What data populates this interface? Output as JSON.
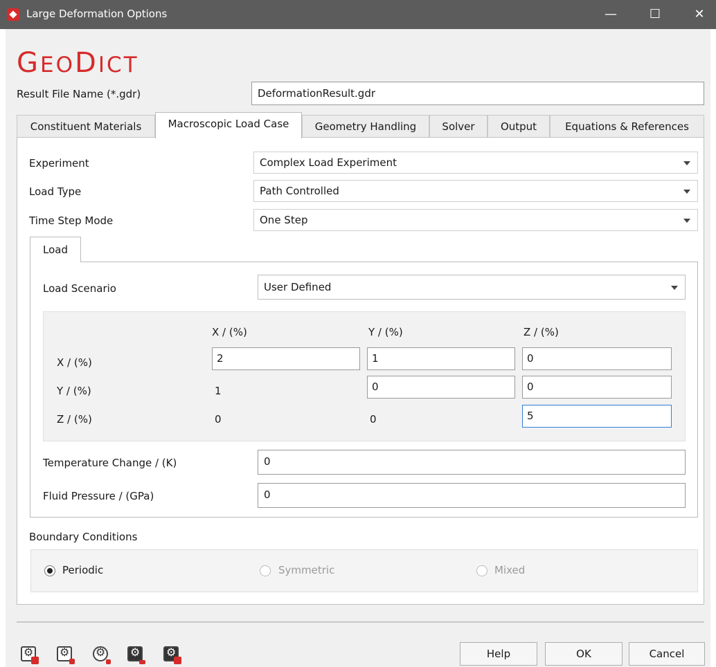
{
  "window": {
    "title": "Large Deformation Options",
    "controls": [
      "—",
      "☐",
      "✕"
    ]
  },
  "logo": {
    "first": "G",
    "rest1": "EO",
    "second": "D",
    "rest2": "ICT"
  },
  "result_file": {
    "label": "Result File Name (*.gdr)",
    "value": "DeformationResult.gdr"
  },
  "tabs": [
    "Constituent Materials",
    "Macroscopic Load Case",
    "Geometry Handling",
    "Solver",
    "Output",
    "Equations & References"
  ],
  "active_tab": "Macroscopic Load Case",
  "experiment": {
    "label": "Experiment",
    "value": "Complex Load Experiment"
  },
  "load_type": {
    "label": "Load Type",
    "value": "Path Controlled"
  },
  "time_step_mode": {
    "label": "Time Step Mode",
    "value": "One Step"
  },
  "load": {
    "tab": "Load",
    "scenario_label": "Load Scenario",
    "scenario_value": "User Defined",
    "col_headers": [
      "X / (%)",
      "Y / (%)",
      "Z / (%)"
    ],
    "row_headers": [
      "X / (%)",
      "Y / (%)",
      "Z / (%)"
    ],
    "matrix": [
      [
        "2",
        "1",
        "0"
      ],
      [
        "1",
        "0",
        "0"
      ],
      [
        "0",
        "0",
        "5"
      ]
    ],
    "temperature": {
      "label": "Temperature Change / (K)",
      "value": "0"
    },
    "pressure": {
      "label": "Fluid Pressure / (GPa)",
      "value": "0"
    }
  },
  "boundary": {
    "label": "Boundary Conditions",
    "options": [
      "Periodic",
      "Symmetric",
      "Mixed"
    ],
    "selected": "Periodic"
  },
  "toolbar_icons": [
    "save-settings-icon",
    "load-settings-icon",
    "reset-settings-icon",
    "export-settings-icon",
    "delete-settings-icon"
  ],
  "buttons": {
    "help": "Help",
    "ok": "OK",
    "cancel": "Cancel"
  }
}
